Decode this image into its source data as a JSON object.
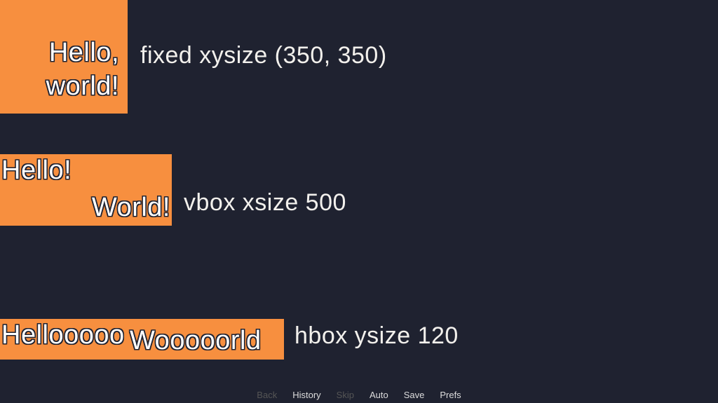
{
  "colors": {
    "accent": "#f78f3f",
    "bg": "#1f2230"
  },
  "blocks": [
    {
      "box_lines": [
        "Hello,",
        "world!"
      ],
      "caption": "fixed xysize (350, 350)"
    },
    {
      "box_lines": [
        "Hello!",
        "World!"
      ],
      "caption": "vbox xsize 500"
    },
    {
      "box_lines": [
        "Hellooooo",
        "Wooooorld"
      ],
      "caption": "hbox ysize 120"
    }
  ],
  "menu": {
    "back": "Back",
    "history": "History",
    "skip": "Skip",
    "auto": "Auto",
    "save": "Save",
    "prefs": "Prefs"
  }
}
